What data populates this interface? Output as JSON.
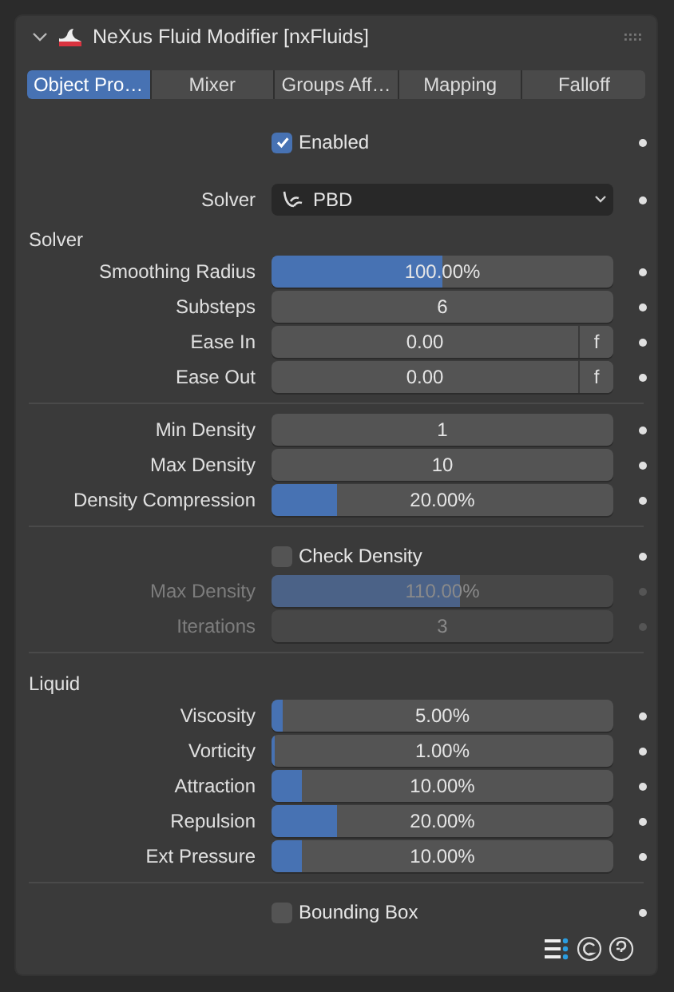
{
  "panel": {
    "title": "NeXus Fluid Modifier [nxFluids]",
    "expanded": true
  },
  "tabs": [
    {
      "label": "Object Pro…",
      "selected": true
    },
    {
      "label": "Mixer",
      "selected": false
    },
    {
      "label": "Groups Aff…",
      "selected": false
    },
    {
      "label": "Mapping",
      "selected": false
    },
    {
      "label": "Falloff",
      "selected": false
    }
  ],
  "items": [
    {
      "kind": "checkbox",
      "label": "Enabled",
      "checked": true,
      "disabled": false
    },
    {
      "kind": "dropdown",
      "label": "Solver",
      "value": "PBD",
      "disabled": false
    },
    {
      "kind": "heading",
      "label": "Solver"
    },
    {
      "kind": "slider",
      "label": "Smoothing Radius",
      "value": "100.00%",
      "level": 0.5,
      "disabled": false
    },
    {
      "kind": "number",
      "label": "Substeps",
      "value": "6",
      "disabled": false
    },
    {
      "kind": "keyframed",
      "label": "Ease In",
      "value": "0.00",
      "button": "f",
      "disabled": false
    },
    {
      "kind": "keyframed",
      "label": "Ease Out",
      "value": "0.00",
      "button": "f",
      "disabled": false
    },
    {
      "kind": "separator"
    },
    {
      "kind": "number",
      "label": "Min Density",
      "value": "1",
      "disabled": false
    },
    {
      "kind": "number",
      "label": "Max Density",
      "value": "10",
      "disabled": false
    },
    {
      "kind": "slider",
      "label": "Density Compression",
      "value": "20.00%",
      "level": 0.19,
      "disabled": false
    },
    {
      "kind": "separator"
    },
    {
      "kind": "checkbox",
      "label": "Check Density",
      "checked": false,
      "disabled": false
    },
    {
      "kind": "slider",
      "label": "Max Density",
      "value": "110.00%",
      "level": 0.55,
      "disabled": true
    },
    {
      "kind": "number",
      "label": "Iterations",
      "value": "3",
      "disabled": true
    },
    {
      "kind": "separator"
    },
    {
      "kind": "heading",
      "label": "Liquid"
    },
    {
      "kind": "slider",
      "label": "Viscosity",
      "value": "5.00%",
      "level": 0.035,
      "disabled": false
    },
    {
      "kind": "slider",
      "label": "Vorticity",
      "value": "1.00%",
      "level": 0.01,
      "disabled": false
    },
    {
      "kind": "slider",
      "label": "Attraction",
      "value": "10.00%",
      "level": 0.09,
      "disabled": false
    },
    {
      "kind": "slider",
      "label": "Repulsion",
      "value": "20.00%",
      "level": 0.19,
      "disabled": false
    },
    {
      "kind": "slider",
      "label": "Ext Pressure",
      "value": "10.00%",
      "level": 0.09,
      "disabled": false
    },
    {
      "kind": "separator"
    },
    {
      "kind": "checkbox",
      "label": "Bounding Box",
      "checked": false,
      "disabled": false
    }
  ]
}
